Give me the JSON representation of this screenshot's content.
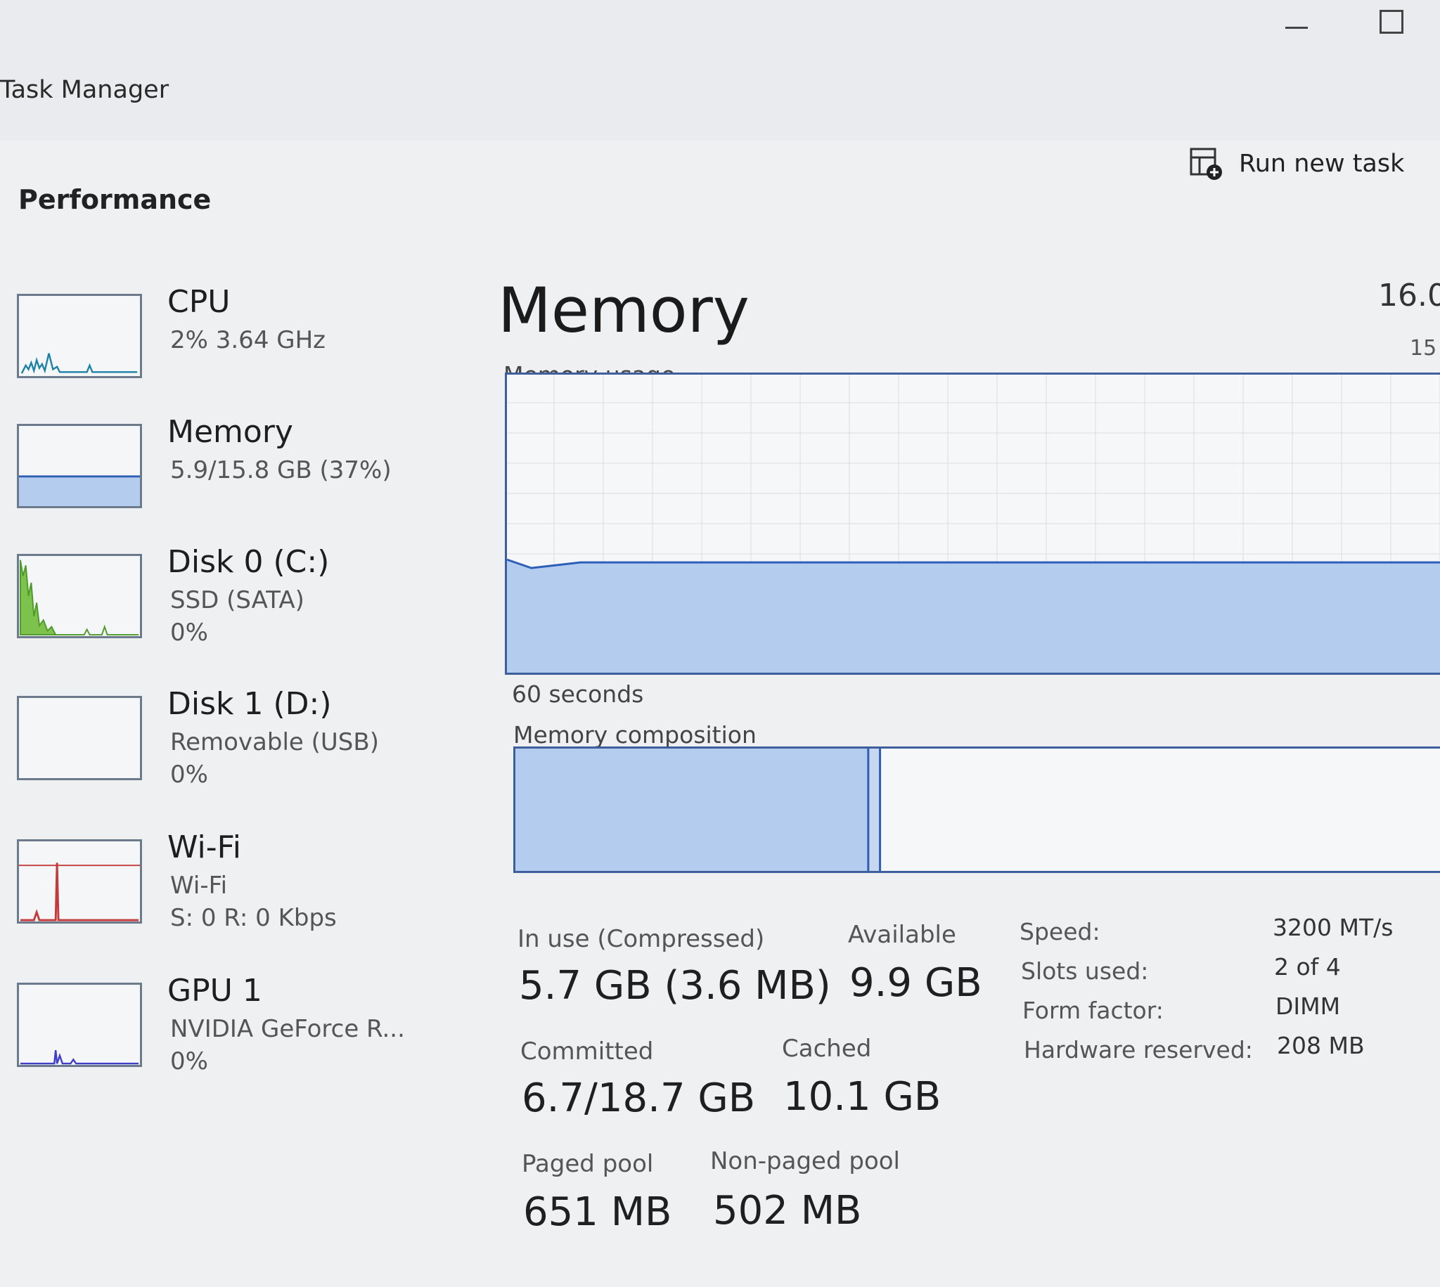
{
  "window": {
    "title": "Task Manager"
  },
  "header": {
    "section_title": "Performance",
    "run_new_task": "Run new task",
    "run_new_task_icon": "run-new-task-icon"
  },
  "colors": {
    "memory_fill": "#b4cdef",
    "memory_line": "#2d5fb8",
    "cpu_line": "#1c82a8",
    "disk_fill": "#7cc24c",
    "wifi_line": "#c43a3a",
    "gpu_line": "#3e3ec8"
  },
  "sidebar": {
    "items": [
      {
        "name": "CPU",
        "sub": "2% 3.64 GHz",
        "sub2": ""
      },
      {
        "name": "Memory",
        "sub": "5.9/15.8 GB (37%)",
        "sub2": ""
      },
      {
        "name": "Disk 0 (C:)",
        "sub": "SSD (SATA)",
        "sub2": "0%"
      },
      {
        "name": "Disk 1 (D:)",
        "sub": "Removable (USB)",
        "sub2": "0%"
      },
      {
        "name": "Wi-Fi",
        "sub": "Wi-Fi",
        "sub2": "S: 0 R: 0 Kbps"
      },
      {
        "name": "GPU 1",
        "sub": "NVIDIA GeForce R...",
        "sub2": "0%"
      }
    ]
  },
  "main": {
    "title": "Memory",
    "total_capacity": "16.0",
    "max_label": "15",
    "usage_label": "Memory usage",
    "time_label": "60 seconds",
    "composition_label": "Memory composition",
    "usage_fraction": 0.37,
    "composition": {
      "in_use_fraction": 0.36,
      "modified_fraction": 0.012
    },
    "stats": [
      {
        "label": "In use (Compressed)",
        "value": "5.7 GB (3.6 MB)"
      },
      {
        "label": "Available",
        "value": "9.9 GB"
      },
      {
        "label": "Committed",
        "value": "6.7/18.7 GB"
      },
      {
        "label": "Cached",
        "value": "10.1 GB"
      },
      {
        "label": "Paged pool",
        "value": "651 MB"
      },
      {
        "label": "Non-paged pool",
        "value": "502 MB"
      }
    ],
    "specs": [
      {
        "key": "Speed:",
        "value": "3200 MT/s"
      },
      {
        "key": "Slots used:",
        "value": "2 of 4"
      },
      {
        "key": "Form factor:",
        "value": "DIMM"
      },
      {
        "key": "Hardware reserved:",
        "value": "208 MB"
      }
    ]
  }
}
